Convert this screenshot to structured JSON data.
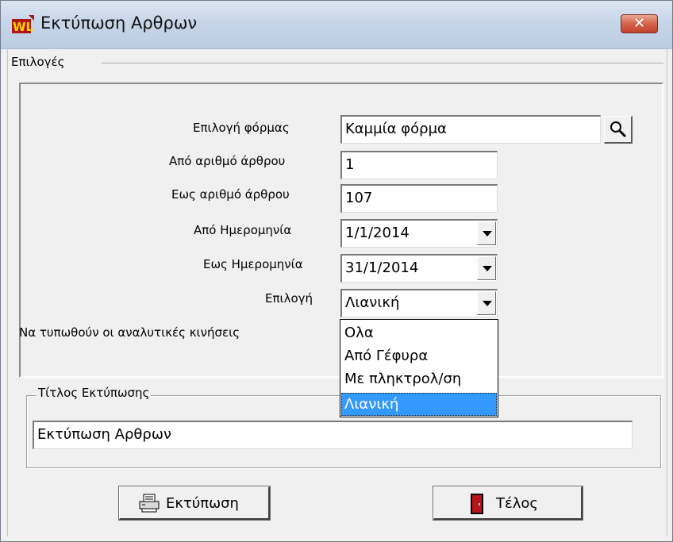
{
  "window": {
    "title": "Εκτύπωση Αρθρων",
    "close_symbol": "✕"
  },
  "options_group": {
    "label": "Επιλογές"
  },
  "form": {
    "form_choice_label": "Επιλογή φόρμας",
    "form_choice_value": "Καμμία φόρμα",
    "from_article_label": "Από αριθμό άρθρου",
    "from_article_value": "1",
    "to_article_label": "Εως αριθμό άρθρου",
    "to_article_value": "107",
    "from_date_label": "Από Ημερομηνία",
    "from_date_value": "1/1/2014",
    "to_date_label": "Εως Ημερομηνία",
    "to_date_value": "31/1/2014",
    "choice_label": "Επιλογή",
    "choice_value": "Λιανική",
    "print_details_label": "Να τυπωθούν οι αναλυτικές κινήσεις"
  },
  "choice_dropdown": {
    "options": [
      "Ολα",
      "Από Γέφυρα",
      "Με πληκτρολ/ση",
      "Λιανική"
    ],
    "selected_index": 3
  },
  "print_title_group": {
    "label": "Τίτλος Εκτύπωσης",
    "value": "Εκτύπωση Αρθρων"
  },
  "buttons": {
    "print_label": "Εκτύπωση",
    "end_label": "Τέλος"
  },
  "icons": {
    "app": "wl-app-icon",
    "close": "close-icon",
    "search": "magnifier-icon",
    "dropdown": "chevron-down-icon",
    "print": "printer-icon",
    "exit": "door-exit-icon"
  },
  "colors": {
    "selection": "#3399ff",
    "close_button": "#c9472f",
    "window_bg": "#f0f0f0"
  }
}
